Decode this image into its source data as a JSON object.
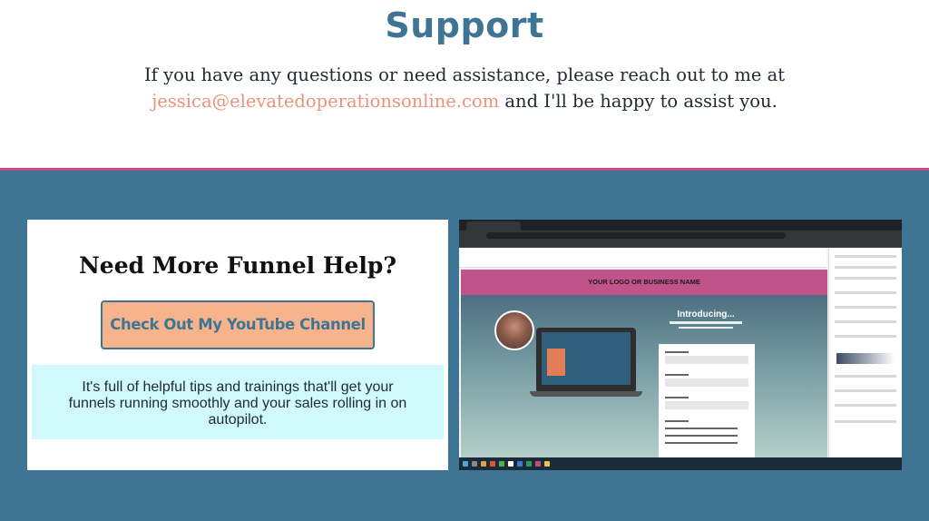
{
  "support": {
    "title": "Support",
    "text_line1": "If you have any questions or need assistance, please reach out to me at",
    "email": "jessica@elevatedoperationsonline.com",
    "text_line2_suffix": " and I'll be happy to assist you."
  },
  "help_card": {
    "title": "Need More Funnel Help?",
    "button_label": "Check Out My YouTube Channel",
    "description": "It's full of helpful tips and trainings that'll get your funnels running smoothly and your sales rolling in on autopilot."
  },
  "screenshot": {
    "logo_bar_text": "YOUR LOGO OR BUSINESS NAME",
    "intro_text": "Introducing..."
  },
  "colors": {
    "heading_blue": "#3f7594",
    "email_accent": "#e89579",
    "divider_pink": "#c94b7f",
    "button_peach": "#f7b48c",
    "tips_bg": "#cff9fb"
  }
}
